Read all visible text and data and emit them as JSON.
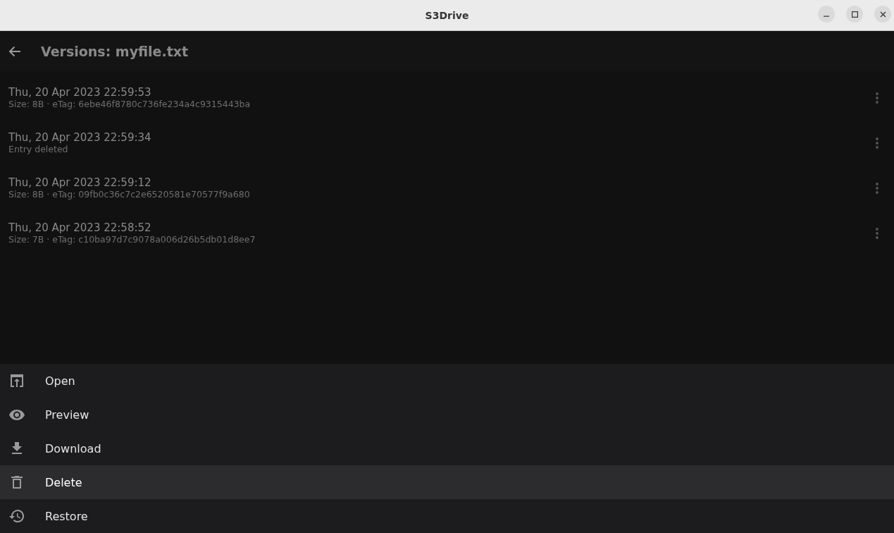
{
  "window": {
    "title": "S3Drive"
  },
  "app_bar": {
    "title": "Versions: myfile.txt"
  },
  "versions": [
    {
      "date": "Thu, 20 Apr 2023 22:59:53",
      "detail": "Size: 8B · eTag: 6ebe46f8780c736fe234a4c9315443ba"
    },
    {
      "date": "Thu, 20 Apr 2023 22:59:34",
      "detail": "Entry deleted"
    },
    {
      "date": "Thu, 20 Apr 2023 22:59:12",
      "detail": "Size: 8B · eTag: 09fb0c36c7c2e6520581e70577f9a680"
    },
    {
      "date": "Thu, 20 Apr 2023 22:58:52",
      "detail": "Size: 7B · eTag: c10ba97d7c9078a006d26b5db01d8ee7"
    }
  ],
  "actions": [
    {
      "label": "Open",
      "kind": "open",
      "selected": false
    },
    {
      "label": "Preview",
      "kind": "preview",
      "selected": false
    },
    {
      "label": "Download",
      "kind": "download",
      "selected": false
    },
    {
      "label": "Delete",
      "kind": "delete",
      "selected": true
    },
    {
      "label": "Restore",
      "kind": "restore",
      "selected": false
    }
  ]
}
